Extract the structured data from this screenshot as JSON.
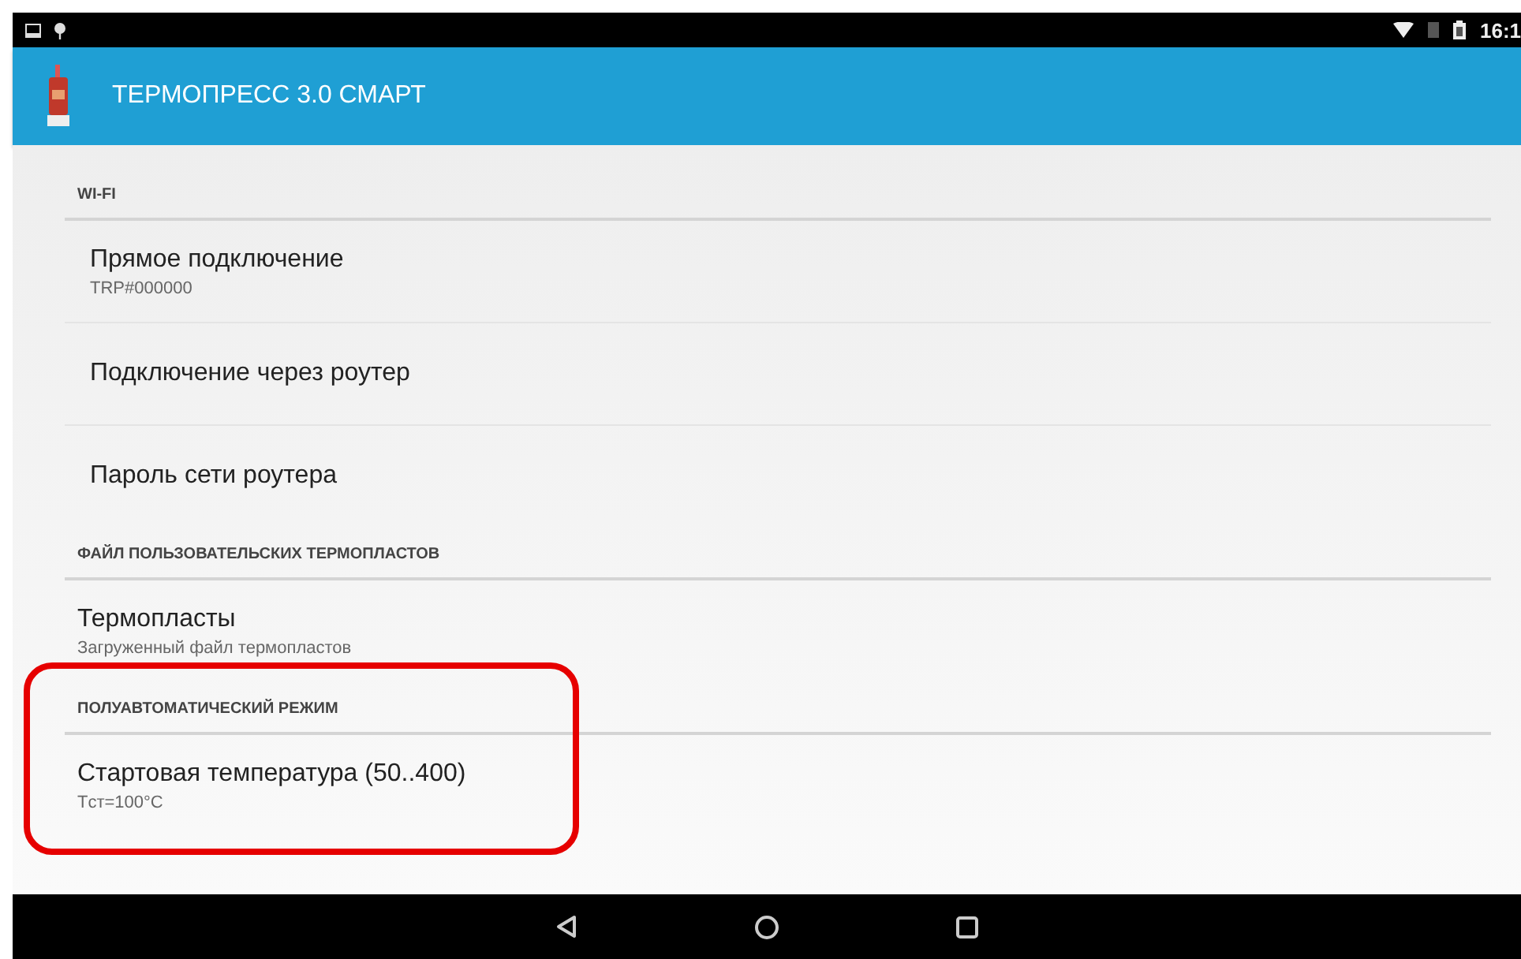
{
  "status_bar": {
    "time": "16:1"
  },
  "app_bar": {
    "title": "ТЕРМОПРЕСС 3.0 СМАРТ"
  },
  "sections": [
    {
      "header": "WI-FI",
      "items": [
        {
          "title": "Прямое подключение",
          "summary": "TRP#000000"
        },
        {
          "title": "Подключение через роутер"
        },
        {
          "title": "Пароль сети роутера"
        }
      ]
    },
    {
      "header": "ФАЙЛ ПОЛЬЗОВАТЕЛЬСКИХ ТЕРМОПЛАСТОВ",
      "items": [
        {
          "title": "Термопласты",
          "summary": "Загруженный файл термопластов"
        }
      ]
    },
    {
      "header": "ПОЛУАВТОМАТИЧЕСКИЙ РЕЖИМ",
      "items": [
        {
          "title": "Стартовая температура (50..400)",
          "summary": "Tст=100°C"
        }
      ]
    }
  ]
}
